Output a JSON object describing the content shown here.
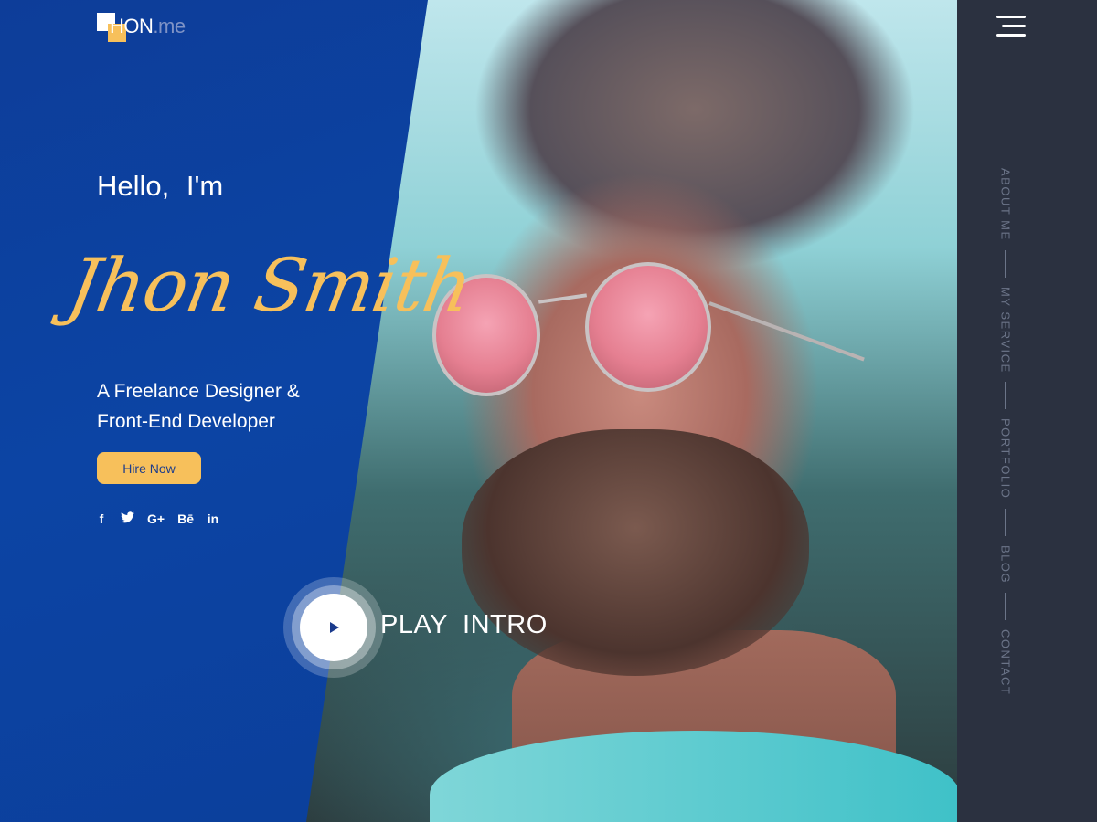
{
  "logo": {
    "text_main": "HON",
    "text_suffix": ".me"
  },
  "hero": {
    "greeting": "Hello,  I'm",
    "name": "Jhon Smith",
    "tagline_line1": "A Freelance Designer &",
    "tagline_line2": "Front-End Developer",
    "cta_label": "Hire Now"
  },
  "social": {
    "items": [
      {
        "icon": "facebook-icon",
        "glyph": "f"
      },
      {
        "icon": "twitter-icon",
        "glyph": "🐦"
      },
      {
        "icon": "google-plus-icon",
        "glyph": "G+"
      },
      {
        "icon": "behance-icon",
        "glyph": "Bē"
      },
      {
        "icon": "linkedin-icon",
        "glyph": "in"
      }
    ]
  },
  "intro": {
    "label": "PLAY  INTRO"
  },
  "nav": {
    "items": [
      "ABOUT ME",
      "MY SERVICE",
      "PORTFOLIO",
      "BLOG",
      "CONTACT"
    ]
  },
  "colors": {
    "primary_blue": "#0c44a4",
    "accent_yellow": "#f7c05b",
    "sidebar_dark": "#2b3140",
    "nav_text": "#6b7488"
  }
}
